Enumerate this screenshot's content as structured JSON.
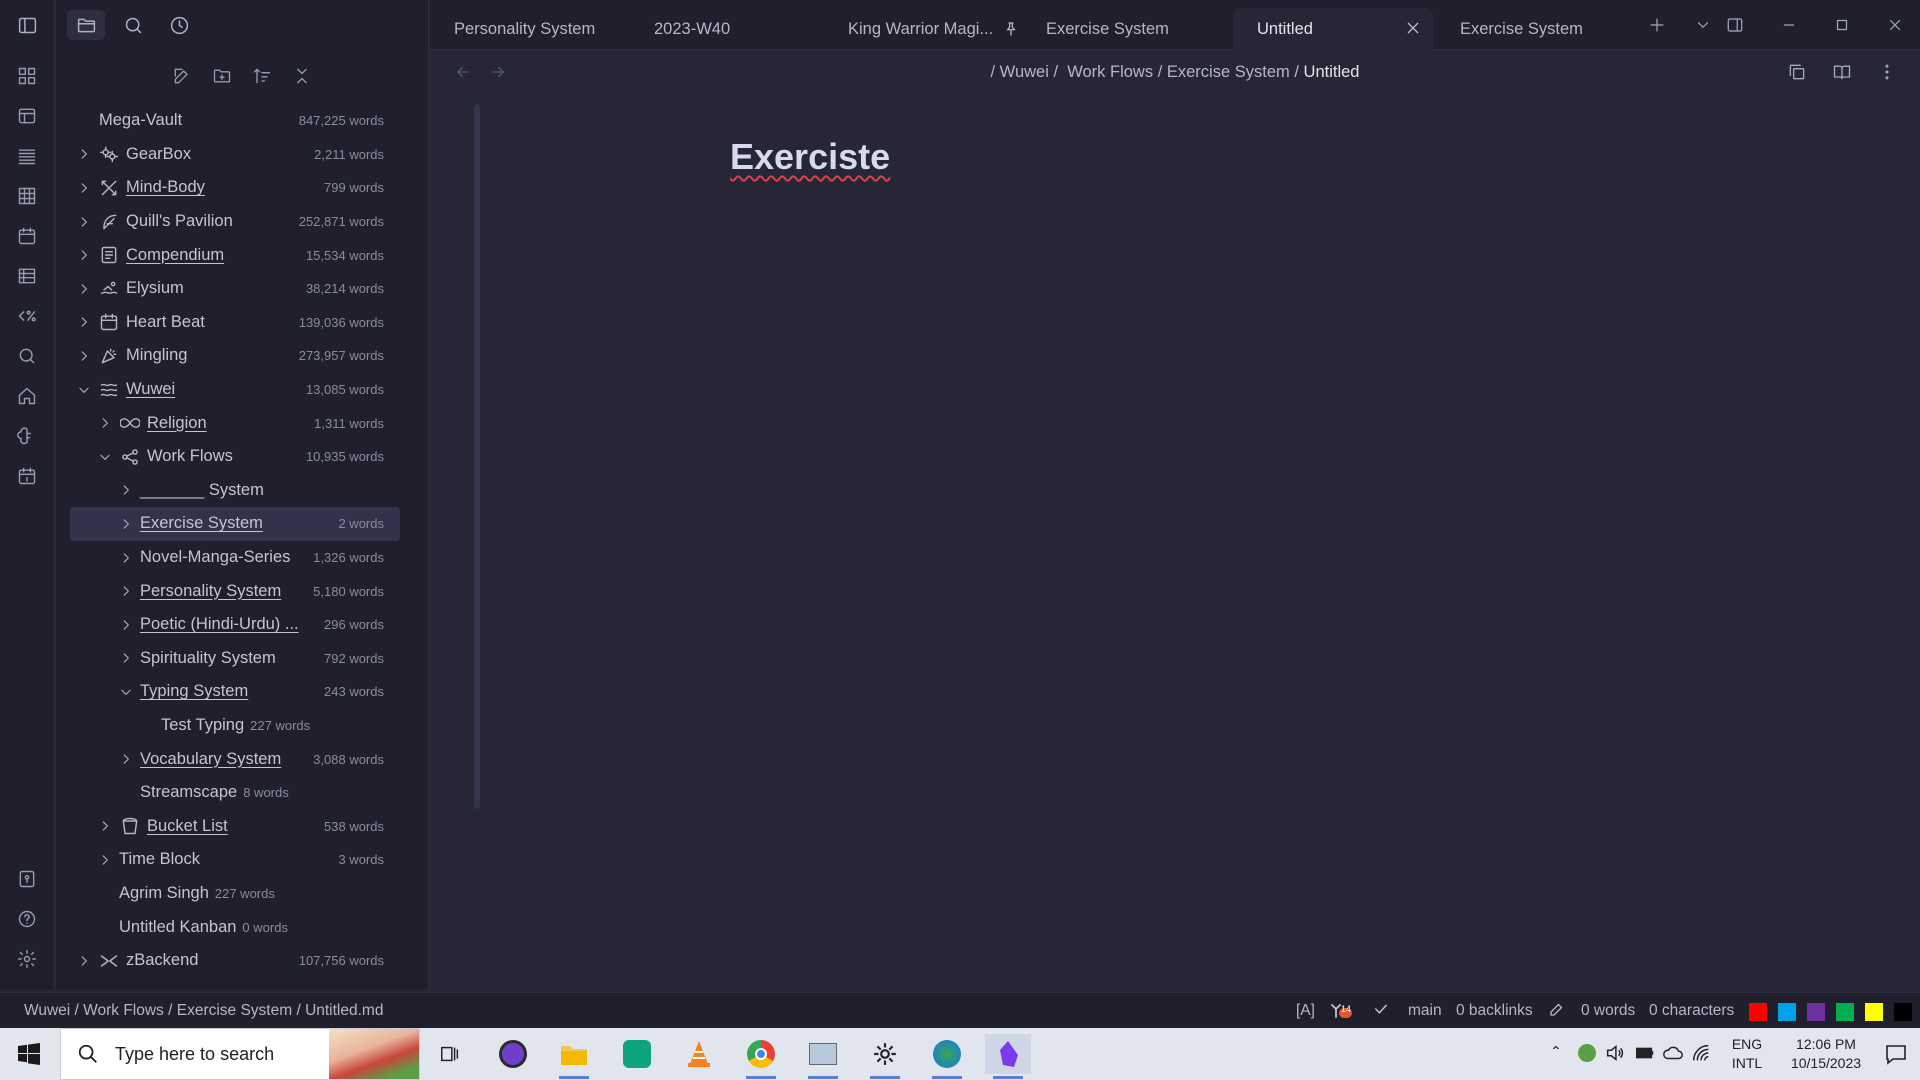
{
  "explorer": {
    "vault_name": "Mega-Vault",
    "vault_count": "847,225 words",
    "items": [
      {
        "name": "GearBox",
        "count": "2,211 words",
        "depth": 0,
        "chevron": "right",
        "icon": "gears-icon",
        "underline": false
      },
      {
        "name": "Mind-Body",
        "count": "799 words",
        "depth": 0,
        "chevron": "right",
        "icon": "tools-icon",
        "underline": true
      },
      {
        "name": "Quill's Pavilion",
        "count": "252,871 words",
        "depth": 0,
        "chevron": "right",
        "icon": "feather-icon",
        "underline": false
      },
      {
        "name": "Compendium",
        "count": "15,534 words",
        "depth": 0,
        "chevron": "right",
        "icon": "book-icon",
        "underline": true
      },
      {
        "name": "Elysium",
        "count": "38,214 words",
        "depth": 0,
        "chevron": "right",
        "icon": "swimmer-icon",
        "underline": false
      },
      {
        "name": "Heart Beat",
        "count": "139,036 words",
        "depth": 0,
        "chevron": "right",
        "icon": "calendar-icon",
        "underline": false
      },
      {
        "name": "Mingling",
        "count": "273,957 words",
        "depth": 0,
        "chevron": "right",
        "icon": "party-icon",
        "underline": false
      },
      {
        "name": "Wuwei",
        "count": "13,085 words",
        "depth": 0,
        "chevron": "down",
        "icon": "waves-icon",
        "underline": true
      },
      {
        "name": "Religion",
        "count": "1,311 words",
        "depth": 1,
        "chevron": "right",
        "icon": "infinity-icon",
        "underline": true
      },
      {
        "name": "Work Flows",
        "count": "10,935 words",
        "depth": 1,
        "chevron": "down",
        "icon": "workflow-icon",
        "underline": false
      },
      {
        "name": "_______ System",
        "count": "",
        "depth": 2,
        "chevron": "right",
        "icon": "",
        "underline": false
      },
      {
        "name": "Exercise System",
        "count": "2 words",
        "depth": 2,
        "chevron": "right",
        "icon": "",
        "underline": true,
        "selected": true
      },
      {
        "name": "Novel-Manga-Series",
        "count": "1,326 words",
        "depth": 2,
        "chevron": "right",
        "icon": "",
        "underline": false
      },
      {
        "name": "Personality System",
        "count": "5,180 words",
        "depth": 2,
        "chevron": "right",
        "icon": "",
        "underline": true
      },
      {
        "name": "Poetic (Hindi-Urdu) ...",
        "count": "296 words",
        "depth": 2,
        "chevron": "right",
        "icon": "",
        "underline": true
      },
      {
        "name": "Spirituality System",
        "count": "792 words",
        "depth": 2,
        "chevron": "right",
        "icon": "",
        "underline": false
      },
      {
        "name": "Typing System",
        "count": "243 words",
        "depth": 2,
        "chevron": "down",
        "icon": "",
        "underline": true
      },
      {
        "name": "Test Typing",
        "count": "227 words",
        "depth": 3,
        "chevron": "",
        "icon": "",
        "underline": false,
        "inline": true
      },
      {
        "name": "Vocabulary System",
        "count": "3,088 words",
        "depth": 2,
        "chevron": "right",
        "icon": "",
        "underline": true
      },
      {
        "name": "Streamscape",
        "count": "8 words",
        "depth": 2,
        "chevron": "",
        "icon": "",
        "underline": false,
        "inline": true
      },
      {
        "name": "Bucket List",
        "count": "538 words",
        "depth": 1,
        "chevron": "right",
        "icon": "bucket-icon",
        "underline": true
      },
      {
        "name": "Time Block",
        "count": "3 words",
        "depth": 1,
        "chevron": "right",
        "icon": "",
        "underline": false
      },
      {
        "name": "Agrim Singh",
        "count": "227 words",
        "depth": 1,
        "chevron": "",
        "icon": "",
        "underline": false,
        "inline": true
      },
      {
        "name": "Untitled Kanban",
        "count": "0 words",
        "depth": 1,
        "chevron": "",
        "icon": "",
        "underline": false,
        "inline": true
      },
      {
        "name": "zBackend",
        "count": "107,756 words",
        "depth": 0,
        "chevron": "right",
        "icon": "link-icon",
        "underline": false
      }
    ]
  },
  "tabs": [
    {
      "label": "Personality System",
      "active": false
    },
    {
      "label": "2023-W40",
      "active": false
    },
    {
      "label": "King Warrior Magi...",
      "active": false,
      "pinned": true
    },
    {
      "label": "Exercise System",
      "active": false
    },
    {
      "label": "Untitled",
      "active": true
    },
    {
      "label": "Exercise System",
      "active": false
    }
  ],
  "breadcrumb": {
    "p1": "/ Wuwei /",
    "p2": "Work Flows",
    "sep": "/",
    "p3": "Exercise System",
    "current": "Untitled"
  },
  "note": {
    "title": "Exerciste"
  },
  "status": {
    "path": "Wuwei /  Work Flows / Exercise System / Untitled.md",
    "mode": "[A]",
    "badge": "14",
    "branch": "main",
    "backlinks": "0 backlinks",
    "words": "0 words",
    "characters": "0 characters",
    "swatches": [
      "#ff0000",
      "#00a2e8",
      "#7030a0",
      "#00b050",
      "#ffff00",
      "#000000"
    ]
  },
  "taskbar": {
    "search_placeholder": "Type here to search",
    "lang1": "ENG",
    "lang2": "INTL",
    "time": "12:06 PM",
    "date": "10/15/2023"
  },
  "colors": {
    "accent": "#7c6cf0",
    "background": "#262637",
    "sidebar": "#1f1f2d"
  }
}
